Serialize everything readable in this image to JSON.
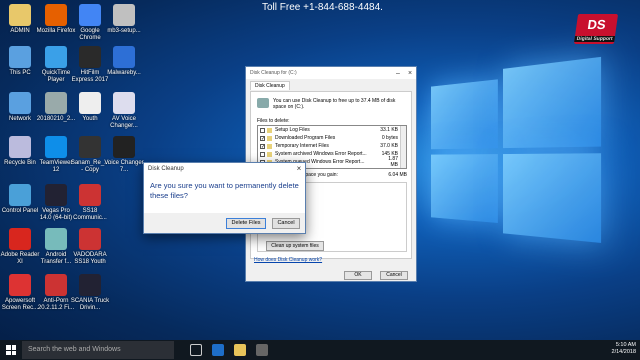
{
  "banner": {
    "text": "Toll Free +1-844-688-4484."
  },
  "brand": {
    "text": "DS",
    "sub": "Digital Support"
  },
  "desktop_icons": [
    {
      "label": "ADMIN",
      "color": "#e8c86a"
    },
    {
      "label": "Mozilla Firefox",
      "color": "#e66000"
    },
    {
      "label": "Google Chrome",
      "color": "#4285f4"
    },
    {
      "label": "mb3-setup...",
      "color": "#c0c0c0"
    },
    {
      "label": "This PC",
      "color": "#5aa0e0"
    },
    {
      "label": "QuickTime Player",
      "color": "#3aa0e8"
    },
    {
      "label": "HitFilm Express 2017",
      "color": "#2a2a2a"
    },
    {
      "label": "Malwareby...",
      "color": "#2d6fd6"
    },
    {
      "label": "Network",
      "color": "#5aa0e0"
    },
    {
      "label": "20180210_2...",
      "color": "#9aa"
    },
    {
      "label": "Youth",
      "color": "#eee"
    },
    {
      "label": "AV Voice Changer...",
      "color": "#dde"
    },
    {
      "label": "Recycle Bin",
      "color": "#bbd"
    },
    {
      "label": "TeamViewer 12",
      "color": "#0e8ee9"
    },
    {
      "label": "Sanam_Re_... - Copy",
      "color": "#333"
    },
    {
      "label": "Voice Changer 7...",
      "color": "#222"
    },
    {
      "label": "Control Panel",
      "color": "#4aa0d8"
    },
    {
      "label": "Vegas Pro 14.0 (64-bit)",
      "color": "#223"
    },
    {
      "label": "SS18 Communic...",
      "color": "#c33"
    },
    {
      "label": "",
      "color": "transparent"
    },
    {
      "label": "Adobe Reader XI",
      "color": "#d8261e"
    },
    {
      "label": "Android Transfer f...",
      "color": "#7bb"
    },
    {
      "label": "VADODARA SS18 Youth",
      "color": "#c33"
    },
    {
      "label": "",
      "color": "transparent"
    },
    {
      "label": "Apowersoft Screen Rec...",
      "color": "#d33"
    },
    {
      "label": "Anti-Porn 20.2.11.2 Fi...",
      "color": "#c33"
    },
    {
      "label": "SCANIA Truck Drivin...",
      "color": "#223"
    }
  ],
  "taskbar": {
    "search_placeholder": "Search the web and Windows",
    "time": "5:10 AM",
    "date": "2/14/2018"
  },
  "disk_cleanup": {
    "title": "Disk Cleanup for (C:)",
    "tab": "Disk Cleanup",
    "intro": "You can use Disk Cleanup to free up to 37.4 MB of disk space on (C:).",
    "files_to_delete_label": "Files to delete:",
    "files": [
      {
        "name": "Setup Log Files",
        "size": "33.1 KB",
        "checked": false
      },
      {
        "name": "Downloaded Program Files",
        "size": "0 bytes",
        "checked": true
      },
      {
        "name": "Temporary Internet Files",
        "size": "37.0 KB",
        "checked": true
      },
      {
        "name": "System archived Windows Error Report...",
        "size": "145 KB",
        "checked": false
      },
      {
        "name": "System queued Windows Error Report...",
        "size": "1.87 MB",
        "checked": false
      }
    ],
    "gain_label": "Total amount of disk space you gain:",
    "gain_value": "6.04 MB",
    "clean_system_label": "Clean up system files",
    "how_link": "How does Disk Cleanup work?",
    "ok_label": "OK",
    "cancel_label": "Cancel"
  },
  "confirm_dialog": {
    "title": "Disk Cleanup",
    "message": "Are you sure you want to permanently delete these files?",
    "delete_label": "Delete Files",
    "cancel_label": "Cancel"
  }
}
